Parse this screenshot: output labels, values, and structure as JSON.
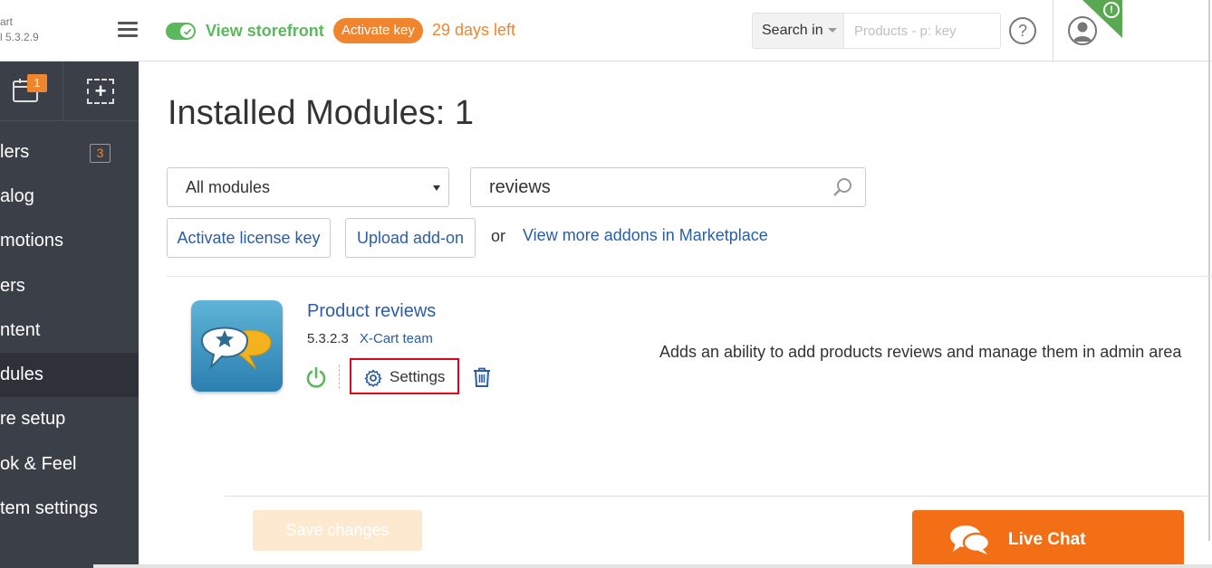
{
  "header": {
    "logo_line1": "art",
    "logo_line2": "l 5.3.2.9",
    "storefront_label": "View storefront",
    "activate_key_label": "Activate key",
    "days_left": "29 days left",
    "search_in_label": "Search in",
    "search_placeholder": "Products - p: key",
    "help_label": "?",
    "notice_label": "!"
  },
  "sidebar": {
    "cal_badge": "1",
    "add_label": "+",
    "items": [
      {
        "label": "lers",
        "badge": "3"
      },
      {
        "label": "alog"
      },
      {
        "label": "motions"
      },
      {
        "label": "ers"
      },
      {
        "label": "ntent"
      },
      {
        "label": "dules",
        "active": true
      },
      {
        "label": "re setup"
      },
      {
        "label": "ok & Feel"
      },
      {
        "label": "tem settings"
      }
    ]
  },
  "main": {
    "title": "Installed Modules: 1",
    "filter_value": "All modules",
    "search_value": "reviews",
    "activate_license_label": "Activate license key",
    "upload_addon_label": "Upload add-on",
    "or_text": "or",
    "marketplace_link": "View more addons in Marketplace",
    "module": {
      "name": "Product reviews",
      "version": "5.3.2.3",
      "author": "X-Cart team",
      "settings_label": "Settings",
      "description": "Adds an ability to add products reviews and manage them in admin area"
    },
    "save_label": "Save changes"
  },
  "chat": {
    "label": "Live Chat"
  },
  "colors": {
    "accent_orange": "#f0852d",
    "storefront_green": "#5cb85c",
    "link_blue": "#2a5ea1",
    "sidebar_bg": "#3b3f48",
    "highlight_red": "#e0001b",
    "chat_orange": "#f26f15"
  }
}
